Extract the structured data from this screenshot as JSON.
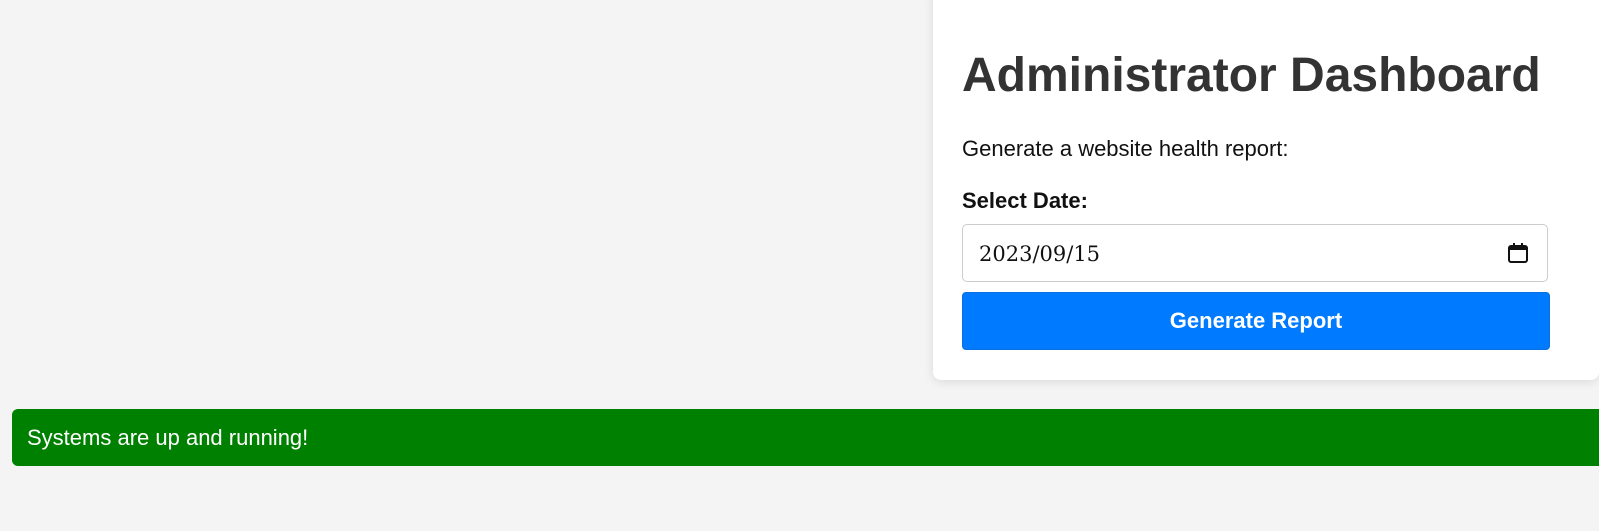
{
  "card": {
    "title": "Administrator Dashboard",
    "description": "Generate a website health report:",
    "date_label": "Select Date:",
    "date_value": "2023/09/15",
    "date_icon": "calendar-icon",
    "button_label": "Generate Report"
  },
  "status": {
    "message": "Systems are up and running!"
  },
  "colors": {
    "background": "#f4f4f4",
    "card": "#ffffff",
    "title": "#333333",
    "button": "#007bff",
    "status_bar": "#008000"
  }
}
